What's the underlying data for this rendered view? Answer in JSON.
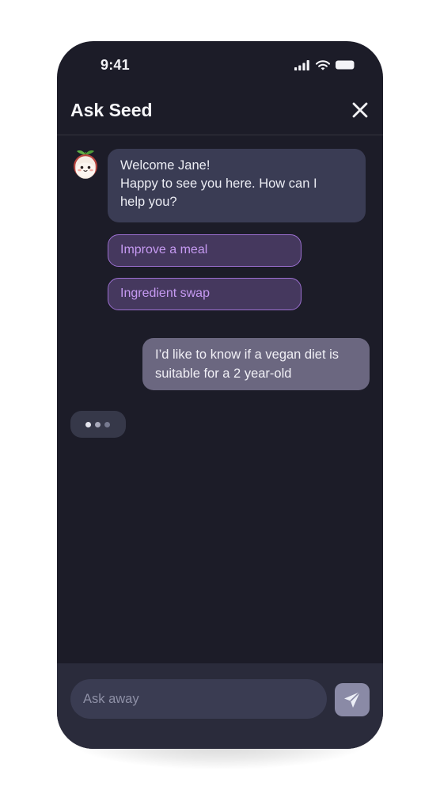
{
  "status_bar": {
    "time": "9:41",
    "icons": [
      "cellular-signal-icon",
      "wifi-icon",
      "battery-icon"
    ]
  },
  "header": {
    "title": "Ask Seed",
    "close_icon": "close-icon"
  },
  "conversation": {
    "bot_avatar_icon": "seed-mascot-icon",
    "bot_message_lines": [
      "Welcome Jane!",
      "Happy to see you here. How can I",
      "help you?"
    ],
    "suggestions": [
      {
        "label": "Improve a meal"
      },
      {
        "label": "Ingredient swap"
      }
    ],
    "user_message_lines": [
      "I’d like to know if a vegan diet is",
      "suitable for a 2 year-old"
    ],
    "typing_indicator_dots": 3
  },
  "composer": {
    "placeholder": "Ask away",
    "value": "",
    "send_icon": "send-icon"
  },
  "colors": {
    "background": "#1c1c28",
    "bot_bubble": "#3a3c54",
    "chip_border": "#9b6fd0",
    "chip_text": "#c69af2",
    "user_bubble": "#6b6780",
    "composer_bg": "#2a2b3b",
    "send_button": "#8a8aa6"
  }
}
